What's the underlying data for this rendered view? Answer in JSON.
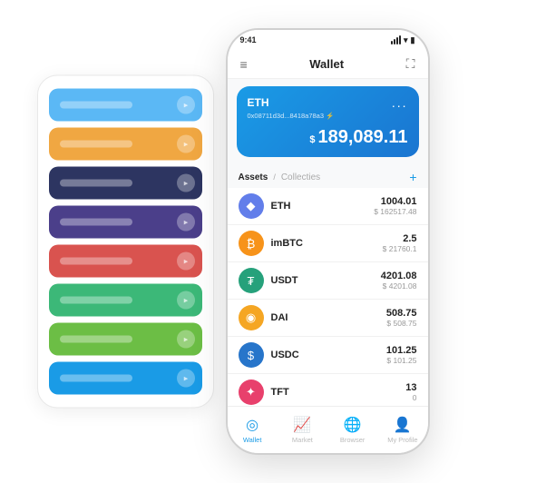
{
  "scene": {
    "back_cards": [
      {
        "color": "#5bb8f5",
        "text": true
      },
      {
        "color": "#f0a742",
        "text": true
      },
      {
        "color": "#2d3561",
        "text": true
      },
      {
        "color": "#4b3f8a",
        "text": true
      },
      {
        "color": "#d9534f",
        "text": true
      },
      {
        "color": "#3cb878",
        "text": true
      },
      {
        "color": "#6cbe45",
        "text": true
      },
      {
        "color": "#1a9be6",
        "text": true
      }
    ]
  },
  "phone": {
    "status_bar": {
      "time": "9:41",
      "signal": "signal",
      "wifi": "wifi",
      "battery": "battery"
    },
    "nav": {
      "menu_icon": "≡",
      "title": "Wallet",
      "expand_icon": "⛶"
    },
    "eth_card": {
      "title": "ETH",
      "dots": "...",
      "address": "0x08711d3d...8418a78a3  ⚡",
      "currency": "$",
      "amount": "189,089.11"
    },
    "assets_header": {
      "tab_active": "Assets",
      "separator": "/",
      "tab_inactive": "Collecties",
      "add_icon": "+"
    },
    "assets": [
      {
        "symbol": "ETH",
        "icon_bg": "#627eea",
        "icon_char": "◆",
        "icon_color": "#fff",
        "amount": "1004.01",
        "usd": "$ 162517.48"
      },
      {
        "symbol": "imBTC",
        "icon_bg": "#f7931a",
        "icon_char": "₿",
        "icon_color": "#fff",
        "amount": "2.5",
        "usd": "$ 21760.1"
      },
      {
        "symbol": "USDT",
        "icon_bg": "#26a17b",
        "icon_char": "₮",
        "icon_color": "#fff",
        "amount": "4201.08",
        "usd": "$ 4201.08"
      },
      {
        "symbol": "DAI",
        "icon_bg": "#f5a623",
        "icon_char": "◉",
        "icon_color": "#fff",
        "amount": "508.75",
        "usd": "$ 508.75"
      },
      {
        "symbol": "USDC",
        "icon_bg": "#2775ca",
        "icon_char": "$",
        "icon_color": "#fff",
        "amount": "101.25",
        "usd": "$ 101.25"
      },
      {
        "symbol": "TFT",
        "icon_bg": "#e8406c",
        "icon_char": "✦",
        "icon_color": "#fff",
        "amount": "13",
        "usd": "0"
      }
    ],
    "bottom_nav": [
      {
        "label": "Wallet",
        "icon": "◎",
        "active": true
      },
      {
        "label": "Market",
        "icon": "📈",
        "active": false
      },
      {
        "label": "Browser",
        "icon": "🌐",
        "active": false
      },
      {
        "label": "My Profile",
        "icon": "👤",
        "active": false
      }
    ]
  }
}
